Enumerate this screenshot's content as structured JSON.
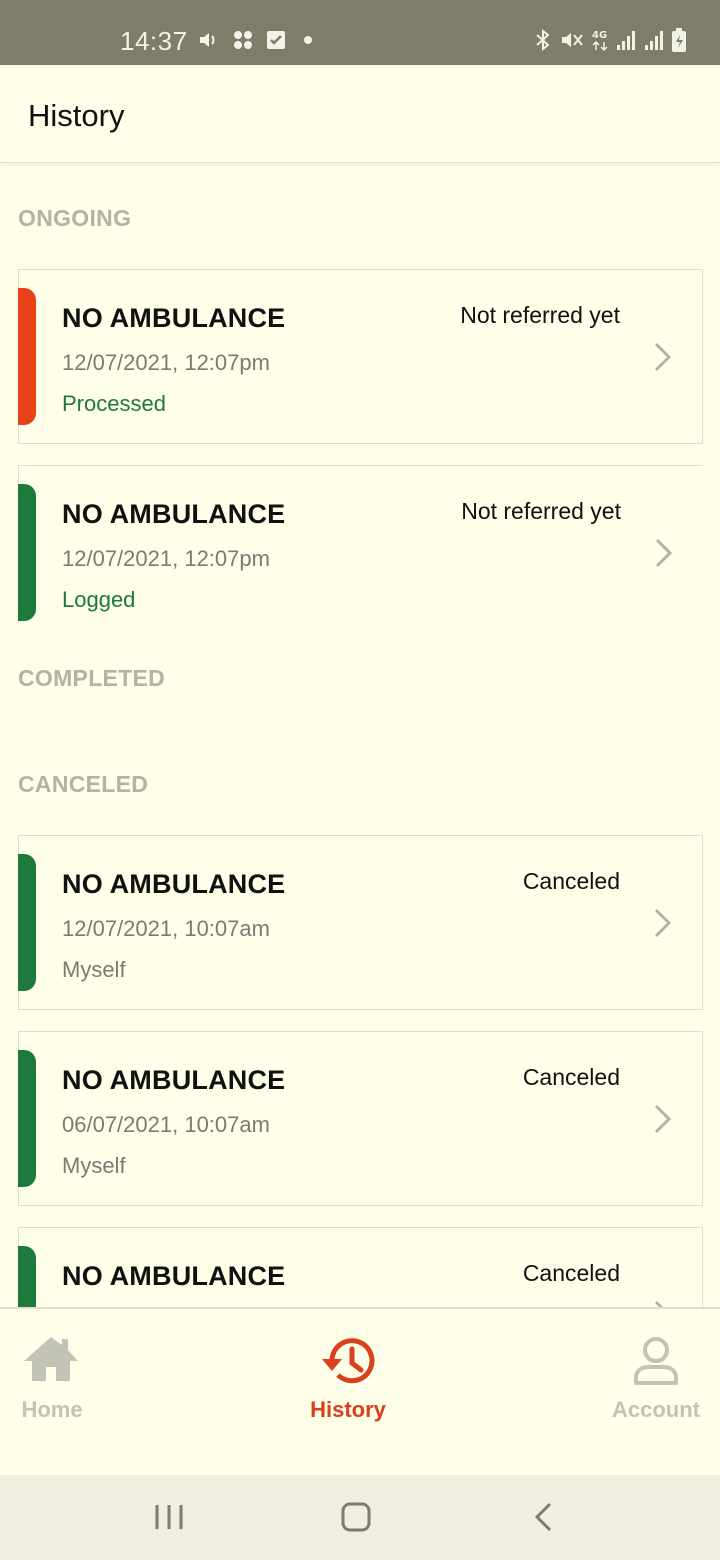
{
  "status_bar": {
    "time": "14:37",
    "left_icons": [
      "volume-icon",
      "apps-icon",
      "check-box-icon",
      "dot-icon"
    ],
    "right_icons": [
      "bluetooth-icon",
      "mute-icon",
      "4g-icon",
      "signal-icon",
      "signal-icon",
      "battery-charging-icon"
    ]
  },
  "header": {
    "title": "History"
  },
  "sections": {
    "ongoing": "ONGOING",
    "completed": "COMPLETED",
    "canceled": "CANCELED"
  },
  "ongoing": [
    {
      "title": "NO AMBULANCE",
      "date": "12/07/2021, 12:07pm",
      "status": "Processed",
      "referral": "Not referred yet",
      "bar_color": "#e8421a"
    },
    {
      "title": "NO AMBULANCE",
      "date": "12/07/2021, 12:07pm",
      "status": "Logged",
      "referral": "Not referred yet",
      "bar_color": "#1d7a3a"
    }
  ],
  "canceled": [
    {
      "title": "NO AMBULANCE",
      "date": "12/07/2021, 10:07am",
      "requester": "Myself",
      "status": "Canceled",
      "bar_color": "#1d7a3a"
    },
    {
      "title": "NO AMBULANCE",
      "date": "06/07/2021, 10:07am",
      "requester": "Myself",
      "status": "Canceled",
      "bar_color": "#1d7a3a"
    },
    {
      "title": "NO AMBULANCE",
      "status": "Canceled",
      "bar_color": "#1d7a3a"
    }
  ],
  "bottom_nav": {
    "home": "Home",
    "history": "History",
    "account": "Account",
    "active": "history"
  },
  "colors": {
    "accent": "#d9401c",
    "status_green": "#1d7a3a",
    "inactive": "#c2c2b6",
    "background": "#fefee9"
  }
}
